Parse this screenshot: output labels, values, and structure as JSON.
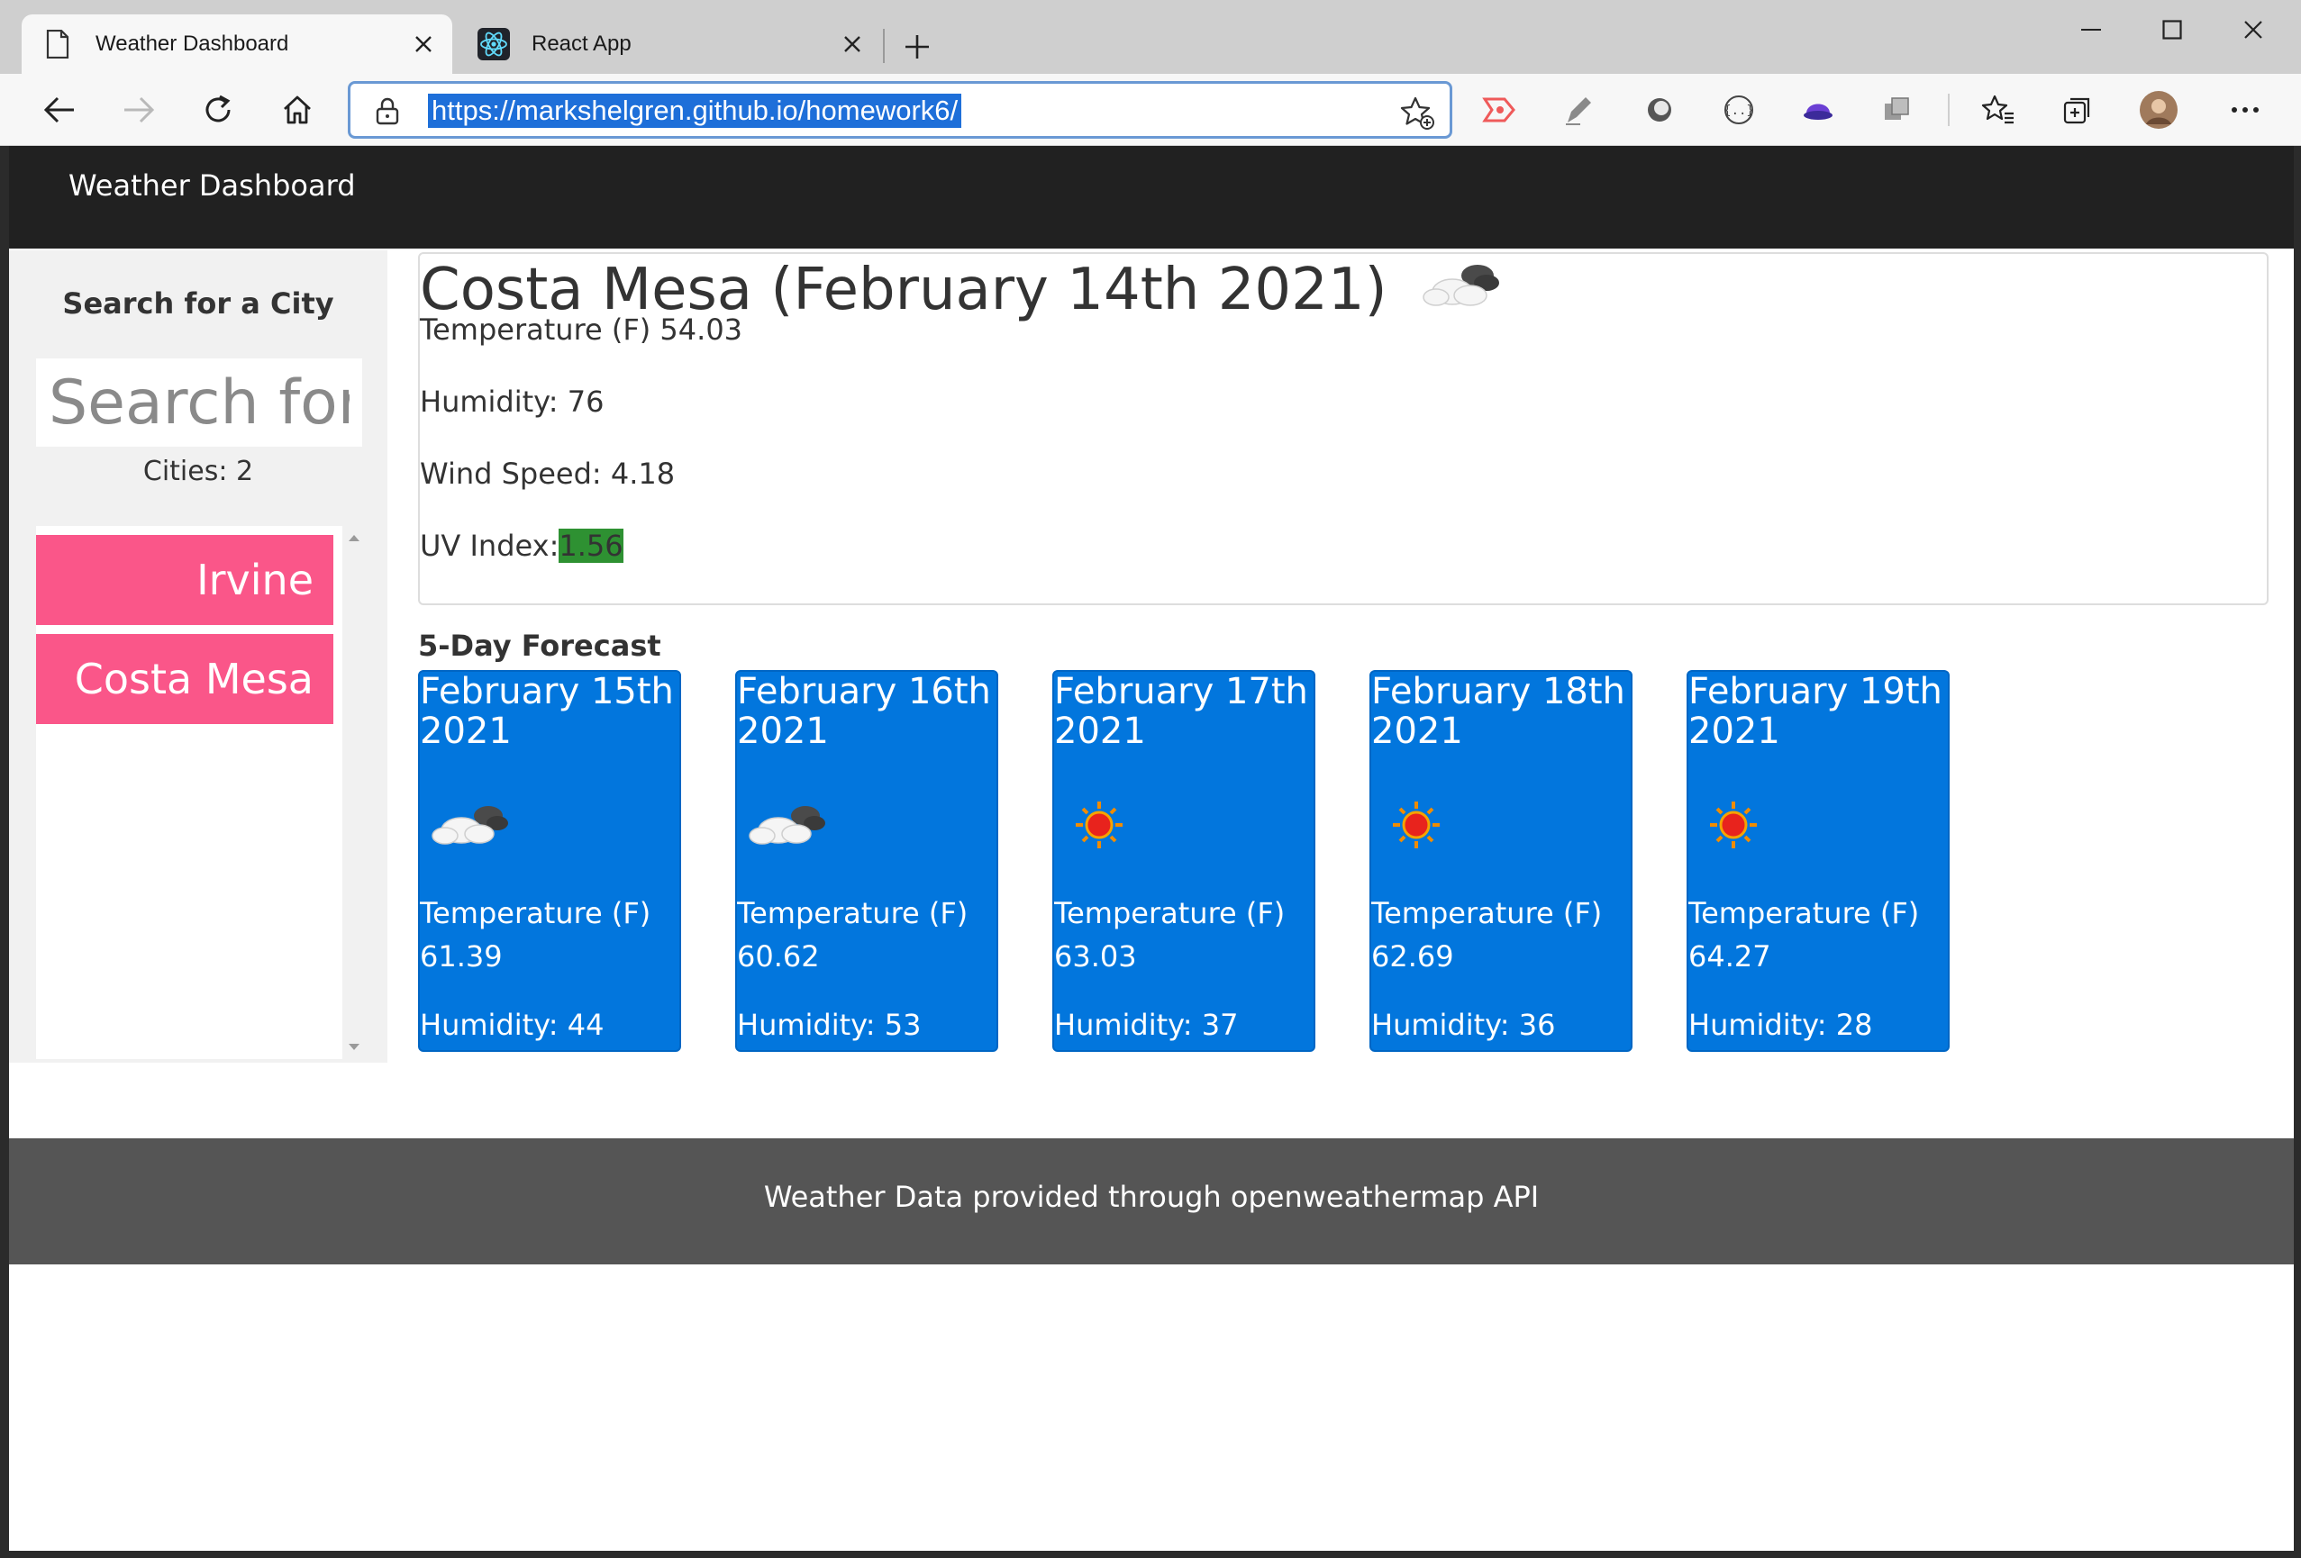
{
  "browser": {
    "tabs": [
      {
        "title": "Weather Dashboard",
        "active": true
      },
      {
        "title": "React App",
        "active": false
      }
    ],
    "address": {
      "url": "https://markshelgren.github.io/homework6/"
    },
    "extensions": [
      "screen-record-icon",
      "pen-icon",
      "circle-extension-icon",
      "code-braces-icon",
      "profile-hat-icon",
      "collections-stack-icon"
    ]
  },
  "app": {
    "title": "Weather Dashboard"
  },
  "sidebar": {
    "heading": "Search for a City",
    "search_placeholder": "Search for a City",
    "city_count_label": "Cities: 2",
    "cities": [
      "Irvine",
      "Costa Mesa"
    ]
  },
  "current": {
    "title": "Costa Mesa (February 14th 2021)",
    "icon": "cloudy-icon",
    "temperature": "Temperature (F) 54.03",
    "humidity": "Humidity: 76",
    "wind": "Wind Speed: 4.18",
    "uv_label": "UV Index:",
    "uv_value": "1.56",
    "uv_color": "#2e9132"
  },
  "forecast": {
    "heading": "5-Day Forecast",
    "card_color": "#0276dd",
    "days": [
      {
        "date": "February 15th 2021",
        "icon": "cloudy-icon",
        "temp_label": "Temperature (F)",
        "temp": "61.39",
        "humidity": "Humidity: 44"
      },
      {
        "date": "February 16th 2021",
        "icon": "cloudy-icon",
        "temp_label": "Temperature (F)",
        "temp": "60.62",
        "humidity": "Humidity: 53"
      },
      {
        "date": "February 17th 2021",
        "icon": "sun-icon",
        "temp_label": "Temperature (F)",
        "temp": "63.03",
        "humidity": "Humidity: 37"
      },
      {
        "date": "February 18th 2021",
        "icon": "sun-icon",
        "temp_label": "Temperature (F)",
        "temp": "62.69",
        "humidity": "Humidity: 36"
      },
      {
        "date": "February 19th 2021",
        "icon": "sun-icon",
        "temp_label": "Temperature (F)",
        "temp": "64.27",
        "humidity": "Humidity: 28"
      }
    ]
  },
  "footer": {
    "text": "Weather Data provided through openweathermap API"
  },
  "colors": {
    "header_bg": "#212121",
    "city_button": "#fa5689",
    "footer_bg": "#555555"
  }
}
